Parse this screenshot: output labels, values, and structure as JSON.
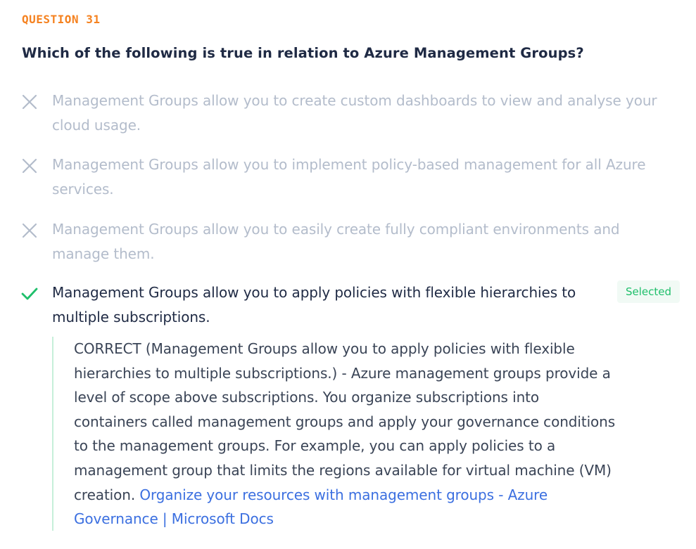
{
  "question": {
    "label": "QUESTION 31",
    "title": "Which of the following is true in relation to Azure Management Groups?"
  },
  "options": [
    {
      "text": "Management Groups allow you to create custom dashboards to view and analyse your cloud usage.",
      "status": "incorrect",
      "icon": "x-icon"
    },
    {
      "text": "Management Groups allow you to implement policy-based management for all Azure services.",
      "status": "incorrect",
      "icon": "x-icon"
    },
    {
      "text": "Management Groups allow you to easily create fully compliant environments and manage them.",
      "status": "incorrect",
      "icon": "x-icon"
    },
    {
      "text": "Management Groups allow you to apply policies with flexible hierarchies to multiple subscriptions.",
      "status": "correct",
      "icon": "check-icon",
      "badge": "Selected"
    }
  ],
  "explanation": {
    "body": "CORRECT (Management Groups allow you to apply policies with flexible hierarchies to multiple subscriptions.) - Azure management groups provide a level of scope above subscriptions. You organize subscriptions into containers called management groups and apply your governance conditions to the management groups. For example, you can apply policies to a management group that limits the regions available for virtual machine (VM) creation.",
    "link_text": "Organize your resources with management groups - Azure Governance | Microsoft Docs"
  },
  "colors": {
    "accent_orange": "#f58220",
    "correct_green": "#1fbf6b",
    "muted_text": "#b3bccb",
    "link_blue": "#3b6fe0"
  }
}
